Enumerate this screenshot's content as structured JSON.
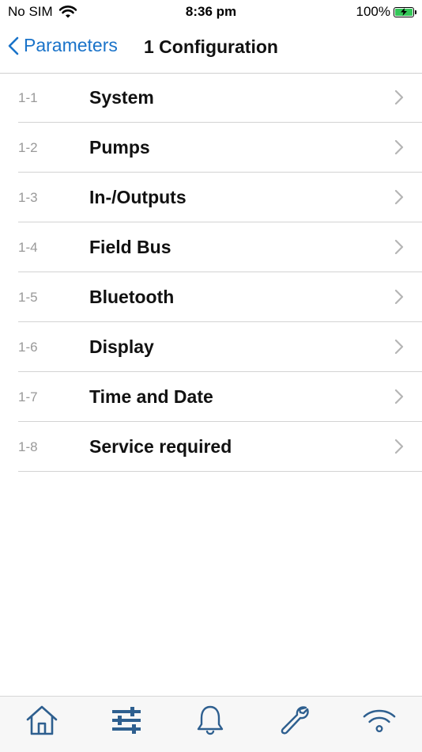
{
  "status_bar": {
    "carrier": "No SIM",
    "time": "8:36 pm",
    "battery": "100%"
  },
  "nav": {
    "back_label": "Parameters",
    "title": "1 Configuration"
  },
  "items": [
    {
      "num": "1-1",
      "label": "System"
    },
    {
      "num": "1-2",
      "label": "Pumps"
    },
    {
      "num": "1-3",
      "label": "In-/Outputs"
    },
    {
      "num": "1-4",
      "label": "Field Bus"
    },
    {
      "num": "1-5",
      "label": "Bluetooth"
    },
    {
      "num": "1-6",
      "label": "Display"
    },
    {
      "num": "1-7",
      "label": "Time and Date"
    },
    {
      "num": "1-8",
      "label": "Service required"
    }
  ],
  "tabs": [
    {
      "icon": "home-icon"
    },
    {
      "icon": "sliders-icon",
      "selected": true
    },
    {
      "icon": "bell-icon"
    },
    {
      "icon": "wrench-icon"
    },
    {
      "icon": "wifi-icon"
    }
  ],
  "colors": {
    "accent": "#1a73c9",
    "tab_icon": "#2e5f8f",
    "battery": "#34c759"
  }
}
